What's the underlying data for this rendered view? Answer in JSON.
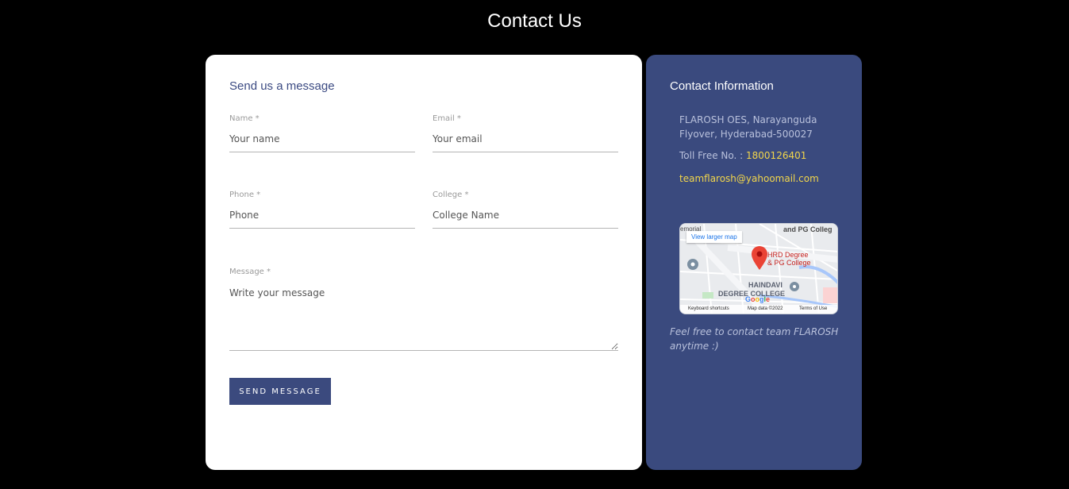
{
  "page": {
    "title": "Contact Us"
  },
  "form": {
    "heading": "Send us a message",
    "name": {
      "label": "Name *",
      "placeholder": "Your name"
    },
    "email": {
      "label": "Email *",
      "placeholder": "Your email"
    },
    "phone": {
      "label": "Phone *",
      "placeholder": "Phone"
    },
    "college": {
      "label": "College *",
      "placeholder": "College Name"
    },
    "message": {
      "label": "Message *",
      "placeholder": "Write your message"
    },
    "submit_label": "SEND MESSAGE"
  },
  "info": {
    "heading": "Contact Information",
    "address": "FLAROSH OES, Narayanguda Flyover, Hyderabad-500027",
    "phone_prefix": "Toll Free No. :",
    "phone_number": "1800126401",
    "email": "teamflarosh@yahoomail.com",
    "tagline": "Feel free to contact team FLAROSH anytime :)"
  },
  "map": {
    "view_larger": "View larger map",
    "place_name_line1": "HRD Degree",
    "place_name_line2": "& PG College",
    "label_top_right": "and PG Colleg",
    "label_top_left": "emorial",
    "label_mid1": "HAINDAVI",
    "label_mid2": "DEGREE COLLEGE",
    "google": "Google",
    "footer_shortcuts": "Keyboard shortcuts",
    "footer_data": "Map data ©2022",
    "footer_terms": "Terms of Use"
  },
  "colors": {
    "accent": "#3a4a7e",
    "highlight": "#f2d64b",
    "background": "#000000"
  }
}
